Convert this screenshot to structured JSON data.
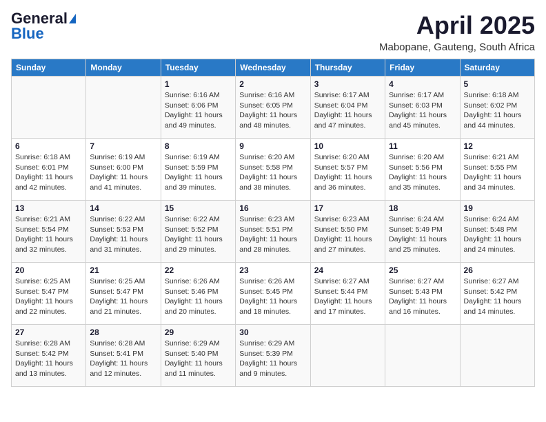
{
  "header": {
    "logo_general": "General",
    "logo_blue": "Blue",
    "month_title": "April 2025",
    "location": "Mabopane, Gauteng, South Africa"
  },
  "days_of_week": [
    "Sunday",
    "Monday",
    "Tuesday",
    "Wednesday",
    "Thursday",
    "Friday",
    "Saturday"
  ],
  "weeks": [
    [
      {
        "day": "",
        "info": ""
      },
      {
        "day": "",
        "info": ""
      },
      {
        "day": "1",
        "info": "Sunrise: 6:16 AM\nSunset: 6:06 PM\nDaylight: 11 hours and 49 minutes."
      },
      {
        "day": "2",
        "info": "Sunrise: 6:16 AM\nSunset: 6:05 PM\nDaylight: 11 hours and 48 minutes."
      },
      {
        "day": "3",
        "info": "Sunrise: 6:17 AM\nSunset: 6:04 PM\nDaylight: 11 hours and 47 minutes."
      },
      {
        "day": "4",
        "info": "Sunrise: 6:17 AM\nSunset: 6:03 PM\nDaylight: 11 hours and 45 minutes."
      },
      {
        "day": "5",
        "info": "Sunrise: 6:18 AM\nSunset: 6:02 PM\nDaylight: 11 hours and 44 minutes."
      }
    ],
    [
      {
        "day": "6",
        "info": "Sunrise: 6:18 AM\nSunset: 6:01 PM\nDaylight: 11 hours and 42 minutes."
      },
      {
        "day": "7",
        "info": "Sunrise: 6:19 AM\nSunset: 6:00 PM\nDaylight: 11 hours and 41 minutes."
      },
      {
        "day": "8",
        "info": "Sunrise: 6:19 AM\nSunset: 5:59 PM\nDaylight: 11 hours and 39 minutes."
      },
      {
        "day": "9",
        "info": "Sunrise: 6:20 AM\nSunset: 5:58 PM\nDaylight: 11 hours and 38 minutes."
      },
      {
        "day": "10",
        "info": "Sunrise: 6:20 AM\nSunset: 5:57 PM\nDaylight: 11 hours and 36 minutes."
      },
      {
        "day": "11",
        "info": "Sunrise: 6:20 AM\nSunset: 5:56 PM\nDaylight: 11 hours and 35 minutes."
      },
      {
        "day": "12",
        "info": "Sunrise: 6:21 AM\nSunset: 5:55 PM\nDaylight: 11 hours and 34 minutes."
      }
    ],
    [
      {
        "day": "13",
        "info": "Sunrise: 6:21 AM\nSunset: 5:54 PM\nDaylight: 11 hours and 32 minutes."
      },
      {
        "day": "14",
        "info": "Sunrise: 6:22 AM\nSunset: 5:53 PM\nDaylight: 11 hours and 31 minutes."
      },
      {
        "day": "15",
        "info": "Sunrise: 6:22 AM\nSunset: 5:52 PM\nDaylight: 11 hours and 29 minutes."
      },
      {
        "day": "16",
        "info": "Sunrise: 6:23 AM\nSunset: 5:51 PM\nDaylight: 11 hours and 28 minutes."
      },
      {
        "day": "17",
        "info": "Sunrise: 6:23 AM\nSunset: 5:50 PM\nDaylight: 11 hours and 27 minutes."
      },
      {
        "day": "18",
        "info": "Sunrise: 6:24 AM\nSunset: 5:49 PM\nDaylight: 11 hours and 25 minutes."
      },
      {
        "day": "19",
        "info": "Sunrise: 6:24 AM\nSunset: 5:48 PM\nDaylight: 11 hours and 24 minutes."
      }
    ],
    [
      {
        "day": "20",
        "info": "Sunrise: 6:25 AM\nSunset: 5:47 PM\nDaylight: 11 hours and 22 minutes."
      },
      {
        "day": "21",
        "info": "Sunrise: 6:25 AM\nSunset: 5:47 PM\nDaylight: 11 hours and 21 minutes."
      },
      {
        "day": "22",
        "info": "Sunrise: 6:26 AM\nSunset: 5:46 PM\nDaylight: 11 hours and 20 minutes."
      },
      {
        "day": "23",
        "info": "Sunrise: 6:26 AM\nSunset: 5:45 PM\nDaylight: 11 hours and 18 minutes."
      },
      {
        "day": "24",
        "info": "Sunrise: 6:27 AM\nSunset: 5:44 PM\nDaylight: 11 hours and 17 minutes."
      },
      {
        "day": "25",
        "info": "Sunrise: 6:27 AM\nSunset: 5:43 PM\nDaylight: 11 hours and 16 minutes."
      },
      {
        "day": "26",
        "info": "Sunrise: 6:27 AM\nSunset: 5:42 PM\nDaylight: 11 hours and 14 minutes."
      }
    ],
    [
      {
        "day": "27",
        "info": "Sunrise: 6:28 AM\nSunset: 5:42 PM\nDaylight: 11 hours and 13 minutes."
      },
      {
        "day": "28",
        "info": "Sunrise: 6:28 AM\nSunset: 5:41 PM\nDaylight: 11 hours and 12 minutes."
      },
      {
        "day": "29",
        "info": "Sunrise: 6:29 AM\nSunset: 5:40 PM\nDaylight: 11 hours and 11 minutes."
      },
      {
        "day": "30",
        "info": "Sunrise: 6:29 AM\nSunset: 5:39 PM\nDaylight: 11 hours and 9 minutes."
      },
      {
        "day": "",
        "info": ""
      },
      {
        "day": "",
        "info": ""
      },
      {
        "day": "",
        "info": ""
      }
    ]
  ]
}
